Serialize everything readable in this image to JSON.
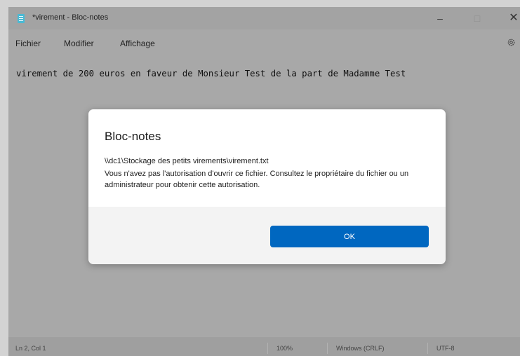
{
  "window": {
    "title": "*virement - Bloc-notes",
    "controls": {
      "minimize": "–",
      "maximize": "□",
      "close": "✕"
    },
    "app_icon": "notepad-icon"
  },
  "menu": {
    "items": [
      "Fichier",
      "Modifier",
      "Affichage"
    ],
    "settings_icon": "gear-icon"
  },
  "editor": {
    "text": "virement de 200 euros en faveur de Monsieur Test de la part de Madamme Test"
  },
  "statusbar": {
    "position": "Ln 2, Col 1",
    "zoom": "100%",
    "line_ending": "Windows (CRLF)",
    "encoding": "UTF-8"
  },
  "dialog": {
    "title": "Bloc-notes",
    "path": "\\\\dc1\\Stockage des petits virements\\virement.txt",
    "message": "Vous n'avez pas l'autorisation d'ouvrir ce fichier. Consultez le propriétaire du fichier ou un administrateur pour obtenir cette autorisation.",
    "ok_label": "OK"
  },
  "colors": {
    "accent": "#0067c0",
    "overlay": "#a8a8a8"
  }
}
